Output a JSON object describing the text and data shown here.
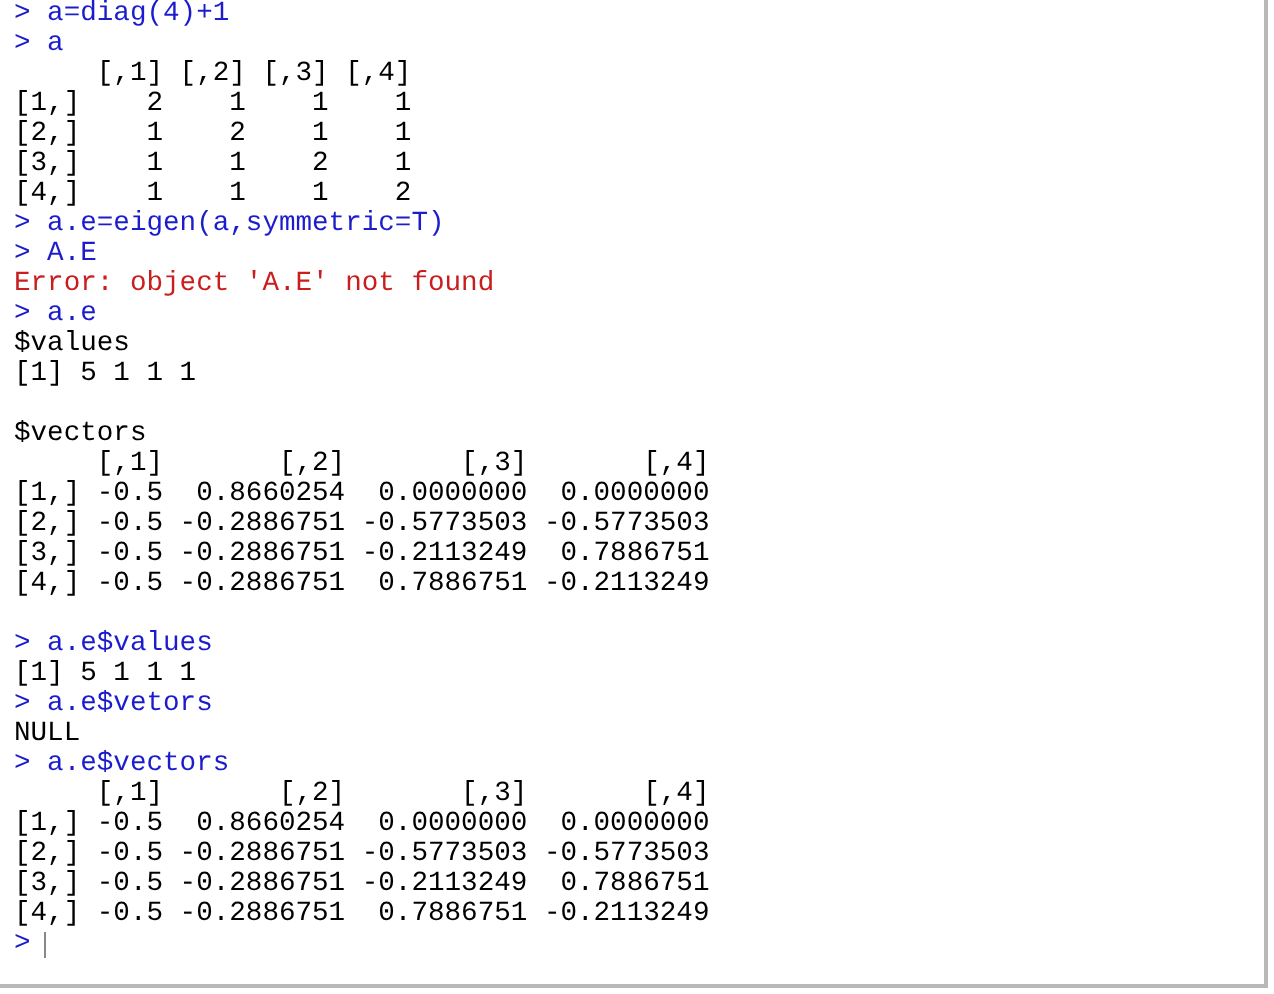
{
  "console": {
    "lines": [
      {
        "kind": "input",
        "prompt": ">",
        "text": "a=diag(4)+1"
      },
      {
        "kind": "input",
        "prompt": ">",
        "text": "a"
      },
      {
        "kind": "output",
        "text": "     [,1] [,2] [,3] [,4]"
      },
      {
        "kind": "output",
        "text": "[1,]    2    1    1    1"
      },
      {
        "kind": "output",
        "text": "[2,]    1    2    1    1"
      },
      {
        "kind": "output",
        "text": "[3,]    1    1    2    1"
      },
      {
        "kind": "output",
        "text": "[4,]    1    1    1    2"
      },
      {
        "kind": "input",
        "prompt": ">",
        "text": "a.e=eigen(a,symmetric=T)"
      },
      {
        "kind": "input",
        "prompt": ">",
        "text": "A.E"
      },
      {
        "kind": "error",
        "text": "Error: object 'A.E' not found"
      },
      {
        "kind": "input",
        "prompt": ">",
        "text": "a.e"
      },
      {
        "kind": "output",
        "text": "$values"
      },
      {
        "kind": "output",
        "text": "[1] 5 1 1 1"
      },
      {
        "kind": "blank"
      },
      {
        "kind": "output",
        "text": "$vectors"
      },
      {
        "kind": "output",
        "text": "     [,1]       [,2]       [,3]       [,4]"
      },
      {
        "kind": "output",
        "text": "[1,] -0.5  0.8660254  0.0000000  0.0000000"
      },
      {
        "kind": "output",
        "text": "[2,] -0.5 -0.2886751 -0.5773503 -0.5773503"
      },
      {
        "kind": "output",
        "text": "[3,] -0.5 -0.2886751 -0.2113249  0.7886751"
      },
      {
        "kind": "output",
        "text": "[4,] -0.5 -0.2886751  0.7886751 -0.2113249"
      },
      {
        "kind": "blank"
      },
      {
        "kind": "input",
        "prompt": ">",
        "text": "a.e$values"
      },
      {
        "kind": "output",
        "text": "[1] 5 1 1 1"
      },
      {
        "kind": "input",
        "prompt": ">",
        "text": "a.e$vetors"
      },
      {
        "kind": "output",
        "text": "NULL"
      },
      {
        "kind": "input",
        "prompt": ">",
        "text": "a.e$vectors"
      },
      {
        "kind": "output",
        "text": "     [,1]       [,2]       [,3]       [,4]"
      },
      {
        "kind": "output",
        "text": "[1,] -0.5  0.8660254  0.0000000  0.0000000"
      },
      {
        "kind": "output",
        "text": "[2,] -0.5 -0.2886751 -0.5773503 -0.5773503"
      },
      {
        "kind": "output",
        "text": "[3,] -0.5 -0.2886751 -0.2113249  0.7886751"
      },
      {
        "kind": "output",
        "text": "[4,] -0.5 -0.2886751  0.7886751 -0.2113249"
      },
      {
        "kind": "cursor",
        "prompt": ">"
      }
    ]
  }
}
